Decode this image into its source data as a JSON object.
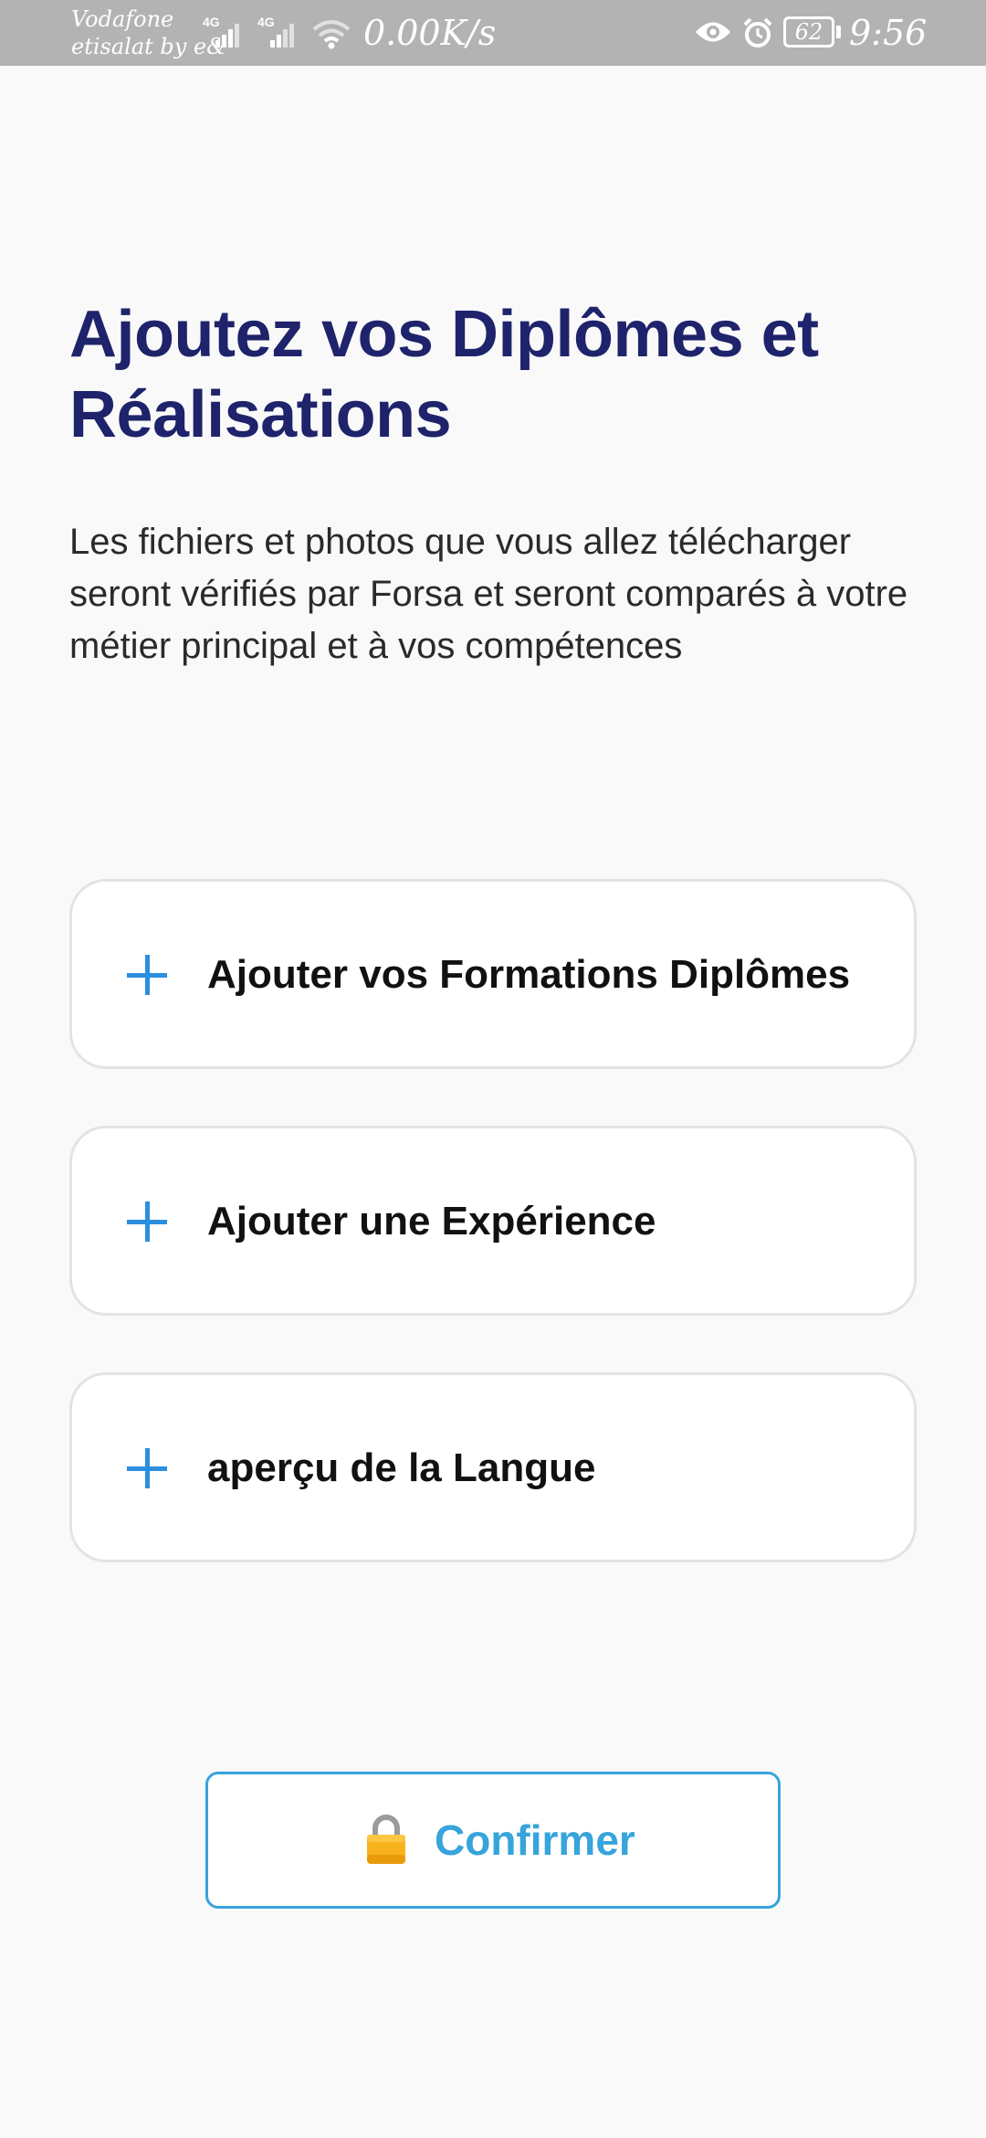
{
  "status_bar": {
    "carrier_line1": "Vodafone",
    "carrier_line2": "etisalat by e&",
    "network_1": "4G",
    "network_2": "4G",
    "net_speed": "0.00K/s",
    "battery": "62",
    "time": "9:56"
  },
  "header": {
    "title": "Ajoutez vos Diplômes et Réalisations",
    "description": "Les fichiers et photos que vous allez télécharger seront vérifiés par Forsa et seront comparés à votre métier principal et à vos compétences"
  },
  "options": [
    {
      "label": "Ajouter vos Formations Diplômes",
      "icon": "plus-icon"
    },
    {
      "label": "Ajouter une Expérience",
      "icon": "plus-icon"
    },
    {
      "label": "aperçu de la Langue",
      "icon": "plus-icon"
    }
  ],
  "confirm": {
    "label": "Confirmer",
    "icon": "lock-icon"
  },
  "colors": {
    "title": "#1e236b",
    "accent": "#37a4dc",
    "plus": "#2b8fe0",
    "background": "#f9f9f9",
    "status_bar": "#b3b3b3"
  }
}
